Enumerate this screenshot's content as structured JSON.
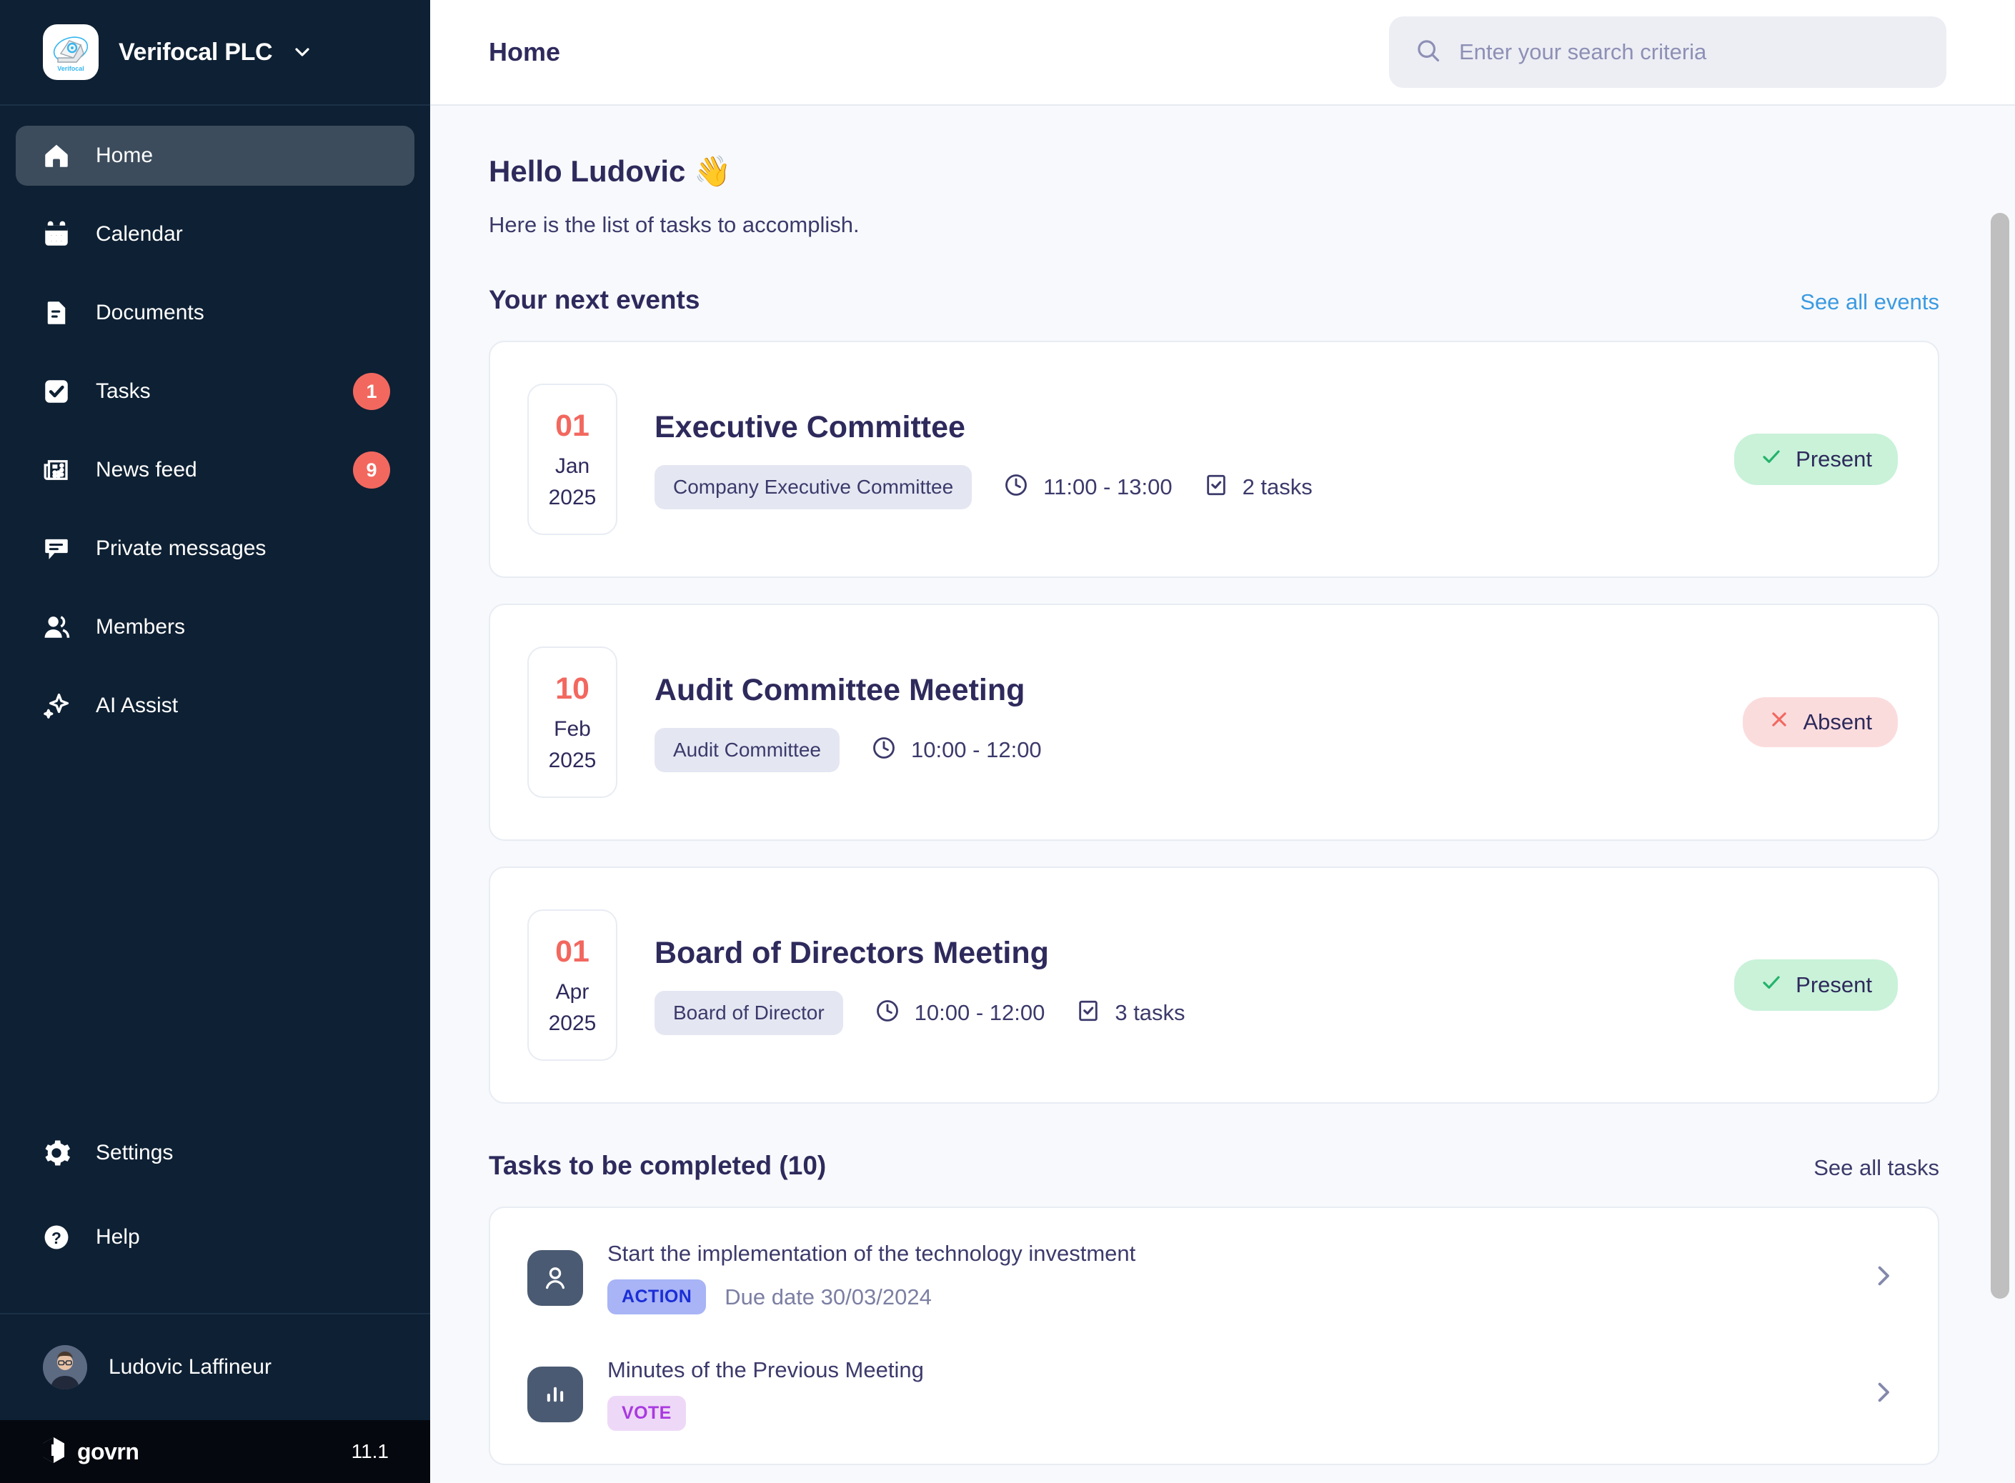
{
  "sidebar": {
    "brand": {
      "name": "Verifocal PLC",
      "logo_text": "Verifocal",
      "caret_icon": "chevron-down-icon"
    },
    "items": [
      {
        "label": "Home",
        "icon": "home-icon",
        "badge": null,
        "active": true
      },
      {
        "label": "Calendar",
        "icon": "calendar-icon",
        "badge": null,
        "active": false
      },
      {
        "label": "Documents",
        "icon": "document-icon",
        "badge": null,
        "active": false
      },
      {
        "label": "Tasks",
        "icon": "check-square-icon",
        "badge": "1",
        "active": false
      },
      {
        "label": "News feed",
        "icon": "newspaper-icon",
        "badge": "9",
        "active": false
      },
      {
        "label": "Private messages",
        "icon": "chat-icon",
        "badge": null,
        "active": false
      },
      {
        "label": "Members",
        "icon": "users-icon",
        "badge": null,
        "active": false
      },
      {
        "label": "AI Assist",
        "icon": "sparkle-icon",
        "badge": null,
        "active": false
      }
    ],
    "bottom_items": [
      {
        "label": "Settings",
        "icon": "gear-icon"
      },
      {
        "label": "Help",
        "icon": "question-circle-icon"
      }
    ],
    "user": {
      "name": "Ludovic Laffineur",
      "avatar_icon": "avatar"
    },
    "footer": {
      "brand": "govrn",
      "logo_icon": "govrn-logo-icon",
      "version": "11.1"
    }
  },
  "topbar": {
    "title": "Home",
    "search": {
      "placeholder": "Enter your search criteria",
      "value": "",
      "icon": "search-icon"
    }
  },
  "main": {
    "greeting": "Hello Ludovic 👋",
    "subtitle": "Here is the list of tasks to accomplish.",
    "events_section": {
      "title": "Your next events",
      "link": "See all events",
      "events": [
        {
          "day": "01",
          "month": "Jan",
          "year": "2025",
          "title": "Executive Committee",
          "tag": "Company Executive Committee",
          "time": "11:00 - 13:00",
          "tasks": "2 tasks",
          "status": "Present",
          "status_type": "present",
          "status_icon": "check-icon",
          "clock_icon": "clock-icon",
          "tasks_icon": "check-square-icon"
        },
        {
          "day": "10",
          "month": "Feb",
          "year": "2025",
          "title": "Audit Committee Meeting",
          "tag": "Audit Committee",
          "time": "10:00 - 12:00",
          "tasks": null,
          "status": "Absent",
          "status_type": "absent",
          "status_icon": "x-icon",
          "clock_icon": "clock-icon",
          "tasks_icon": "check-square-icon"
        },
        {
          "day": "01",
          "month": "Apr",
          "year": "2025",
          "title": "Board of Directors Meeting",
          "tag": "Board of Director",
          "time": "10:00 - 12:00",
          "tasks": "3 tasks",
          "status": "Present",
          "status_type": "present",
          "status_icon": "check-icon",
          "clock_icon": "clock-icon",
          "tasks_icon": "check-square-icon"
        }
      ]
    },
    "tasks_section": {
      "title": "Tasks to be completed (10)",
      "link": "See all tasks",
      "tasks": [
        {
          "title": "Start the implementation of the technology investment",
          "type": "ACTION",
          "type_class": "action",
          "due": "Due date 30/03/2024",
          "icon": "person-icon",
          "chevron_icon": "chevron-right-icon"
        },
        {
          "title": "Minutes of the Previous Meeting",
          "type": "VOTE",
          "type_class": "vote",
          "due": null,
          "icon": "bar-chart-icon",
          "chevron_icon": "chevron-right-icon"
        }
      ]
    }
  },
  "colors": {
    "sidebar_bg": "#0e2033",
    "sidebar_active": "#3c4c5c",
    "badge_red": "#f2685f",
    "link_blue": "#3b9ae1",
    "heading": "#2e2a5c",
    "present_bg": "#c9f2d9",
    "absent_bg": "#fbdcdd",
    "action_bg": "#a8b4f5",
    "vote_bg": "#eed8f7"
  }
}
